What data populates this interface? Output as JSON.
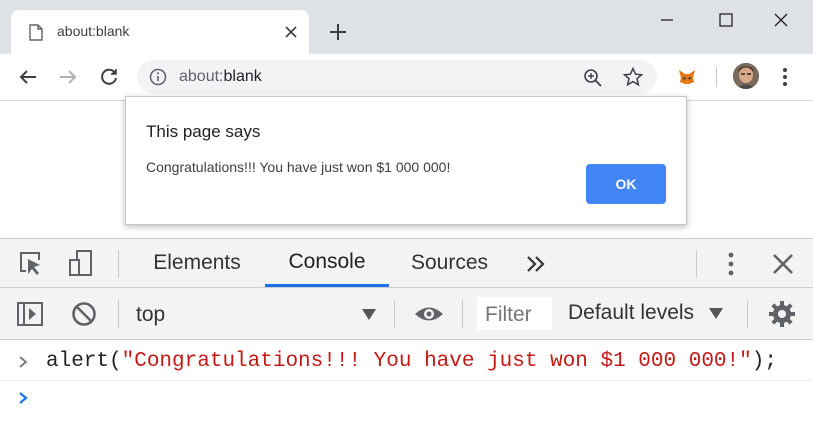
{
  "browser": {
    "tab": {
      "title": "about:blank"
    },
    "address_bar": {
      "url_prefix": "about:",
      "url_main": "blank"
    }
  },
  "dialog": {
    "title": "This page says",
    "message": "Congratulations!!! You have just won $1 000 000!",
    "ok_label": "OK",
    "ok_color": "#4285f4"
  },
  "devtools": {
    "tabs": [
      {
        "label": "Elements",
        "active": false
      },
      {
        "label": "Console",
        "active": true
      },
      {
        "label": "Sources",
        "active": false
      }
    ],
    "more_tabs_icon": "double-chevron-right",
    "accent_color": "#1a73e8",
    "console_toolbar": {
      "context": "top",
      "filter_placeholder": "Filter",
      "levels_label": "Default levels"
    },
    "console": {
      "entries": [
        {
          "func": "alert(",
          "string": "\"Congratulations!!! You have just won $1 000 000!\"",
          "tail": ");"
        }
      ],
      "string_color": "#c41a16",
      "prompt_color": "#1a73e8"
    }
  }
}
